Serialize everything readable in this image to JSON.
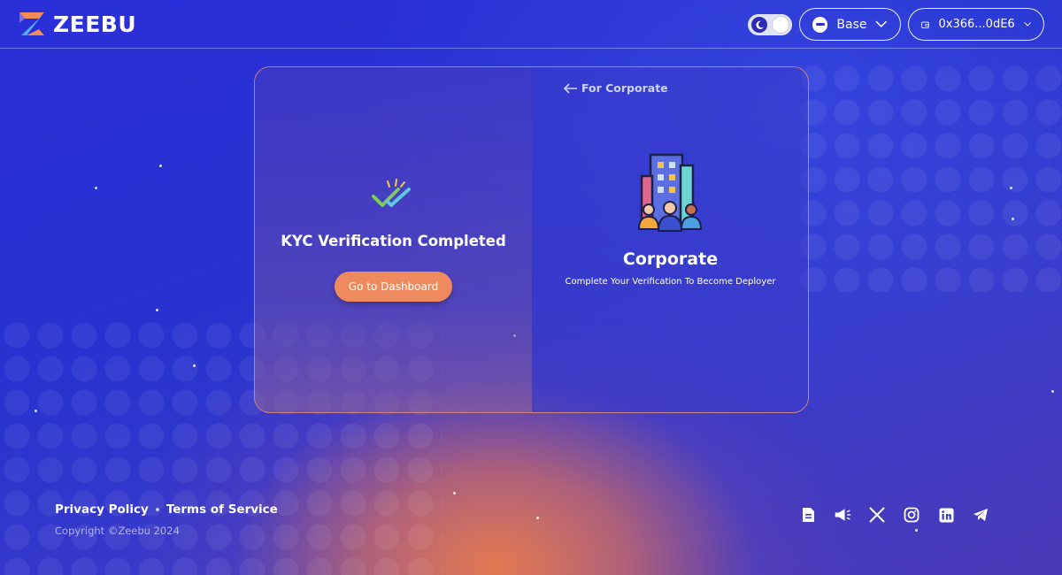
{
  "header": {
    "brand": "ZEEBU",
    "network_label": "Base",
    "wallet_address": "0x366...0dE6"
  },
  "kyc_panel": {
    "title": "KYC Verification Completed",
    "button_label": "Go to Dashboard"
  },
  "corporate_panel": {
    "back_label": "For Corporate",
    "title": "Corporate",
    "subtitle": "Complete Your Verification To Become Deployer"
  },
  "footer": {
    "privacy_label": "Privacy Policy",
    "terms_label": "Terms of Service",
    "copyright": "Copyright ©Zeebu 2024",
    "social_icons": [
      "document-icon",
      "megaphone-icon",
      "x-icon",
      "instagram-icon",
      "linkedin-icon",
      "telegram-icon"
    ]
  },
  "colors": {
    "accent": "#ef8a5f",
    "background": "#2733d0"
  }
}
